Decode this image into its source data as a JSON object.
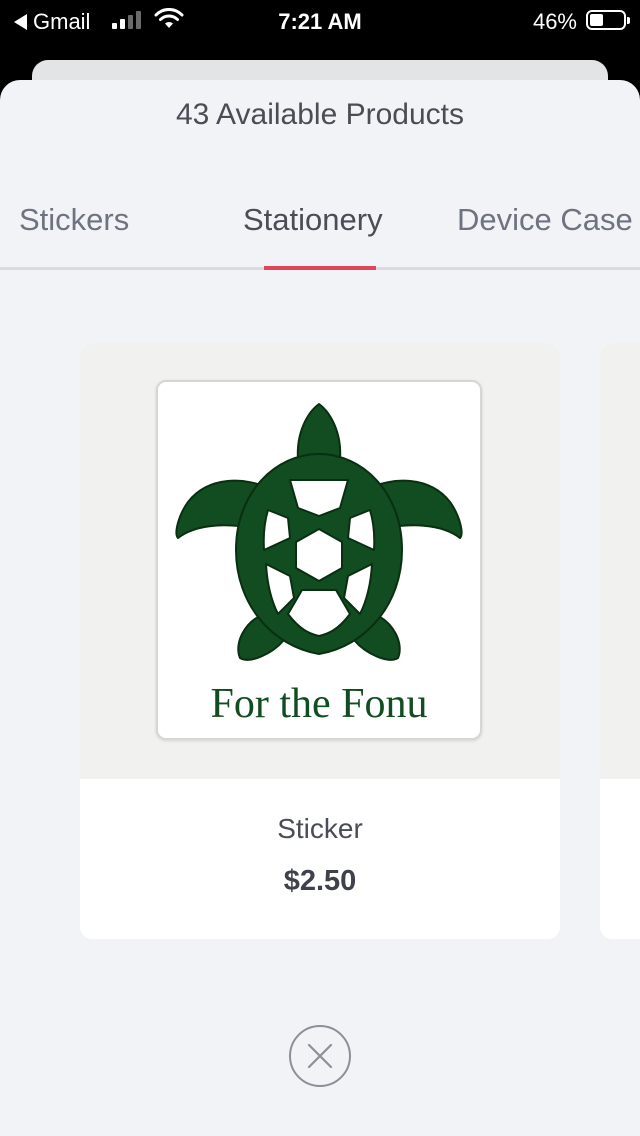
{
  "status_bar": {
    "back_app": "Gmail",
    "time": "7:21 AM",
    "battery_percent": "46%",
    "battery_level": 0.46,
    "signal_bars": 2,
    "icons": [
      "back-arrow-icon",
      "cellular-signal-icon",
      "wifi-icon",
      "battery-icon"
    ]
  },
  "sheet": {
    "title": "43 Available Products"
  },
  "tabs": {
    "items": [
      {
        "label": "Stickers",
        "active": false
      },
      {
        "label": "Stationery",
        "active": true
      },
      {
        "label": "Device Case",
        "active": false
      }
    ],
    "indicator_color": "#e0465a"
  },
  "products": [
    {
      "name": "Sticker",
      "price": "$2.50",
      "image_caption": "For the Fonu",
      "image_color": "#114d20"
    }
  ],
  "close_button": {
    "icon": "close-icon"
  }
}
